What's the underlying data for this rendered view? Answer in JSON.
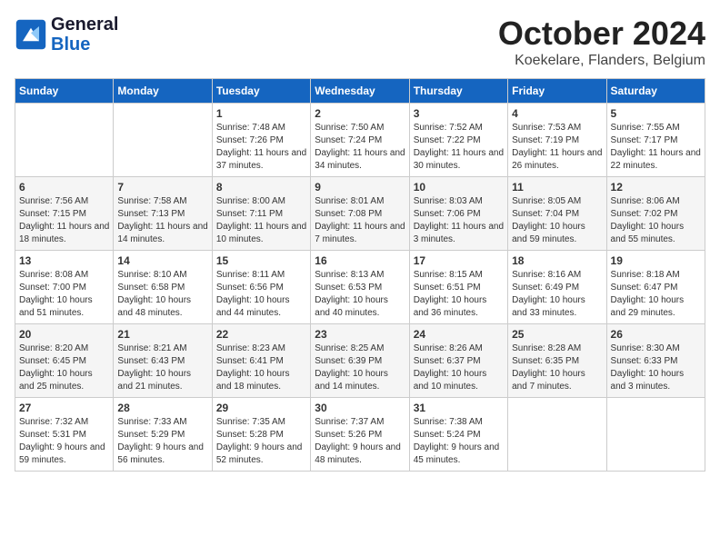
{
  "header": {
    "logo_line1": "General",
    "logo_line2": "Blue",
    "month_title": "October 2024",
    "location": "Koekelare, Flanders, Belgium"
  },
  "days_of_week": [
    "Sunday",
    "Monday",
    "Tuesday",
    "Wednesday",
    "Thursday",
    "Friday",
    "Saturday"
  ],
  "weeks": [
    [
      null,
      null,
      {
        "day": 1,
        "sunrise": "7:48 AM",
        "sunset": "7:26 PM",
        "daylight": "11 hours and 37 minutes."
      },
      {
        "day": 2,
        "sunrise": "7:50 AM",
        "sunset": "7:24 PM",
        "daylight": "11 hours and 34 minutes."
      },
      {
        "day": 3,
        "sunrise": "7:52 AM",
        "sunset": "7:22 PM",
        "daylight": "11 hours and 30 minutes."
      },
      {
        "day": 4,
        "sunrise": "7:53 AM",
        "sunset": "7:19 PM",
        "daylight": "11 hours and 26 minutes."
      },
      {
        "day": 5,
        "sunrise": "7:55 AM",
        "sunset": "7:17 PM",
        "daylight": "11 hours and 22 minutes."
      }
    ],
    [
      {
        "day": 6,
        "sunrise": "7:56 AM",
        "sunset": "7:15 PM",
        "daylight": "11 hours and 18 minutes."
      },
      {
        "day": 7,
        "sunrise": "7:58 AM",
        "sunset": "7:13 PM",
        "daylight": "11 hours and 14 minutes."
      },
      {
        "day": 8,
        "sunrise": "8:00 AM",
        "sunset": "7:11 PM",
        "daylight": "11 hours and 10 minutes."
      },
      {
        "day": 9,
        "sunrise": "8:01 AM",
        "sunset": "7:08 PM",
        "daylight": "11 hours and 7 minutes."
      },
      {
        "day": 10,
        "sunrise": "8:03 AM",
        "sunset": "7:06 PM",
        "daylight": "11 hours and 3 minutes."
      },
      {
        "day": 11,
        "sunrise": "8:05 AM",
        "sunset": "7:04 PM",
        "daylight": "10 hours and 59 minutes."
      },
      {
        "day": 12,
        "sunrise": "8:06 AM",
        "sunset": "7:02 PM",
        "daylight": "10 hours and 55 minutes."
      }
    ],
    [
      {
        "day": 13,
        "sunrise": "8:08 AM",
        "sunset": "7:00 PM",
        "daylight": "10 hours and 51 minutes."
      },
      {
        "day": 14,
        "sunrise": "8:10 AM",
        "sunset": "6:58 PM",
        "daylight": "10 hours and 48 minutes."
      },
      {
        "day": 15,
        "sunrise": "8:11 AM",
        "sunset": "6:56 PM",
        "daylight": "10 hours and 44 minutes."
      },
      {
        "day": 16,
        "sunrise": "8:13 AM",
        "sunset": "6:53 PM",
        "daylight": "10 hours and 40 minutes."
      },
      {
        "day": 17,
        "sunrise": "8:15 AM",
        "sunset": "6:51 PM",
        "daylight": "10 hours and 36 minutes."
      },
      {
        "day": 18,
        "sunrise": "8:16 AM",
        "sunset": "6:49 PM",
        "daylight": "10 hours and 33 minutes."
      },
      {
        "day": 19,
        "sunrise": "8:18 AM",
        "sunset": "6:47 PM",
        "daylight": "10 hours and 29 minutes."
      }
    ],
    [
      {
        "day": 20,
        "sunrise": "8:20 AM",
        "sunset": "6:45 PM",
        "daylight": "10 hours and 25 minutes."
      },
      {
        "day": 21,
        "sunrise": "8:21 AM",
        "sunset": "6:43 PM",
        "daylight": "10 hours and 21 minutes."
      },
      {
        "day": 22,
        "sunrise": "8:23 AM",
        "sunset": "6:41 PM",
        "daylight": "10 hours and 18 minutes."
      },
      {
        "day": 23,
        "sunrise": "8:25 AM",
        "sunset": "6:39 PM",
        "daylight": "10 hours and 14 minutes."
      },
      {
        "day": 24,
        "sunrise": "8:26 AM",
        "sunset": "6:37 PM",
        "daylight": "10 hours and 10 minutes."
      },
      {
        "day": 25,
        "sunrise": "8:28 AM",
        "sunset": "6:35 PM",
        "daylight": "10 hours and 7 minutes."
      },
      {
        "day": 26,
        "sunrise": "8:30 AM",
        "sunset": "6:33 PM",
        "daylight": "10 hours and 3 minutes."
      }
    ],
    [
      {
        "day": 27,
        "sunrise": "7:32 AM",
        "sunset": "5:31 PM",
        "daylight": "9 hours and 59 minutes."
      },
      {
        "day": 28,
        "sunrise": "7:33 AM",
        "sunset": "5:29 PM",
        "daylight": "9 hours and 56 minutes."
      },
      {
        "day": 29,
        "sunrise": "7:35 AM",
        "sunset": "5:28 PM",
        "daylight": "9 hours and 52 minutes."
      },
      {
        "day": 30,
        "sunrise": "7:37 AM",
        "sunset": "5:26 PM",
        "daylight": "9 hours and 48 minutes."
      },
      {
        "day": 31,
        "sunrise": "7:38 AM",
        "sunset": "5:24 PM",
        "daylight": "9 hours and 45 minutes."
      },
      null,
      null
    ]
  ]
}
